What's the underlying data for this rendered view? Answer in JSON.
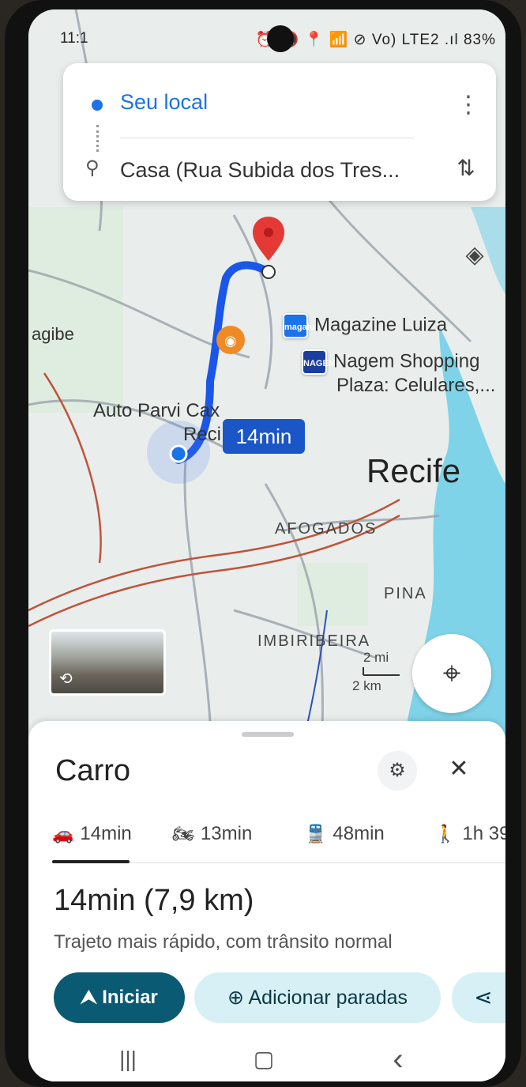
{
  "status_bar": {
    "time": "11:1",
    "icons": "⏰ 🔇 📍 📶 ⊘ Vo) LTE2 .ıl",
    "battery": "83%"
  },
  "directions": {
    "origin": "Seu local",
    "destination": "Casa (Rua Subida dos Tres...",
    "menu_icon": "⋮",
    "swap_icon": "⇅",
    "pin_icon": "⚲"
  },
  "map": {
    "layers_icon": "◈",
    "pois": [
      {
        "icon": "magalu",
        "label": "Magazine Luiza"
      },
      {
        "icon": "NAGEM",
        "label": "Nagem Shopping"
      },
      {
        "label": "Plaza: Celulares,..."
      },
      {
        "label": "Auto Parvi Cax"
      },
      {
        "label": "Reci"
      },
      {
        "label": "agibe"
      }
    ],
    "city": "Recife",
    "neighborhoods": [
      "AFOGADOS",
      "PINA",
      "IMBIRIBEIRA"
    ],
    "route_badge": "14min",
    "scale": {
      "mi": "2 mi",
      "km": "2 km"
    },
    "gps_icon": "⌖",
    "street_view_icon": "⟲"
  },
  "sheet": {
    "mode_title": "Carro",
    "tune_icon": "⚙",
    "close_icon": "✕",
    "tabs": [
      {
        "icon": "🚗",
        "label": "14min"
      },
      {
        "icon": "🏍",
        "label": "13min"
      },
      {
        "icon": "🚆",
        "label": "48min"
      },
      {
        "icon": "🚶",
        "label": "1h 39"
      }
    ],
    "route_time": "14min (7,9 km)",
    "route_desc": "Trajeto mais rápido, com trânsito normal",
    "start_label": "Iniciar",
    "start_icon": "⮝",
    "stops_label": "Adicionar paradas",
    "stops_icon": "⊕",
    "share_icon": "⋖"
  },
  "navbar": {
    "recents_icon": "|||",
    "home_icon": "▢",
    "back_icon": "‹"
  }
}
